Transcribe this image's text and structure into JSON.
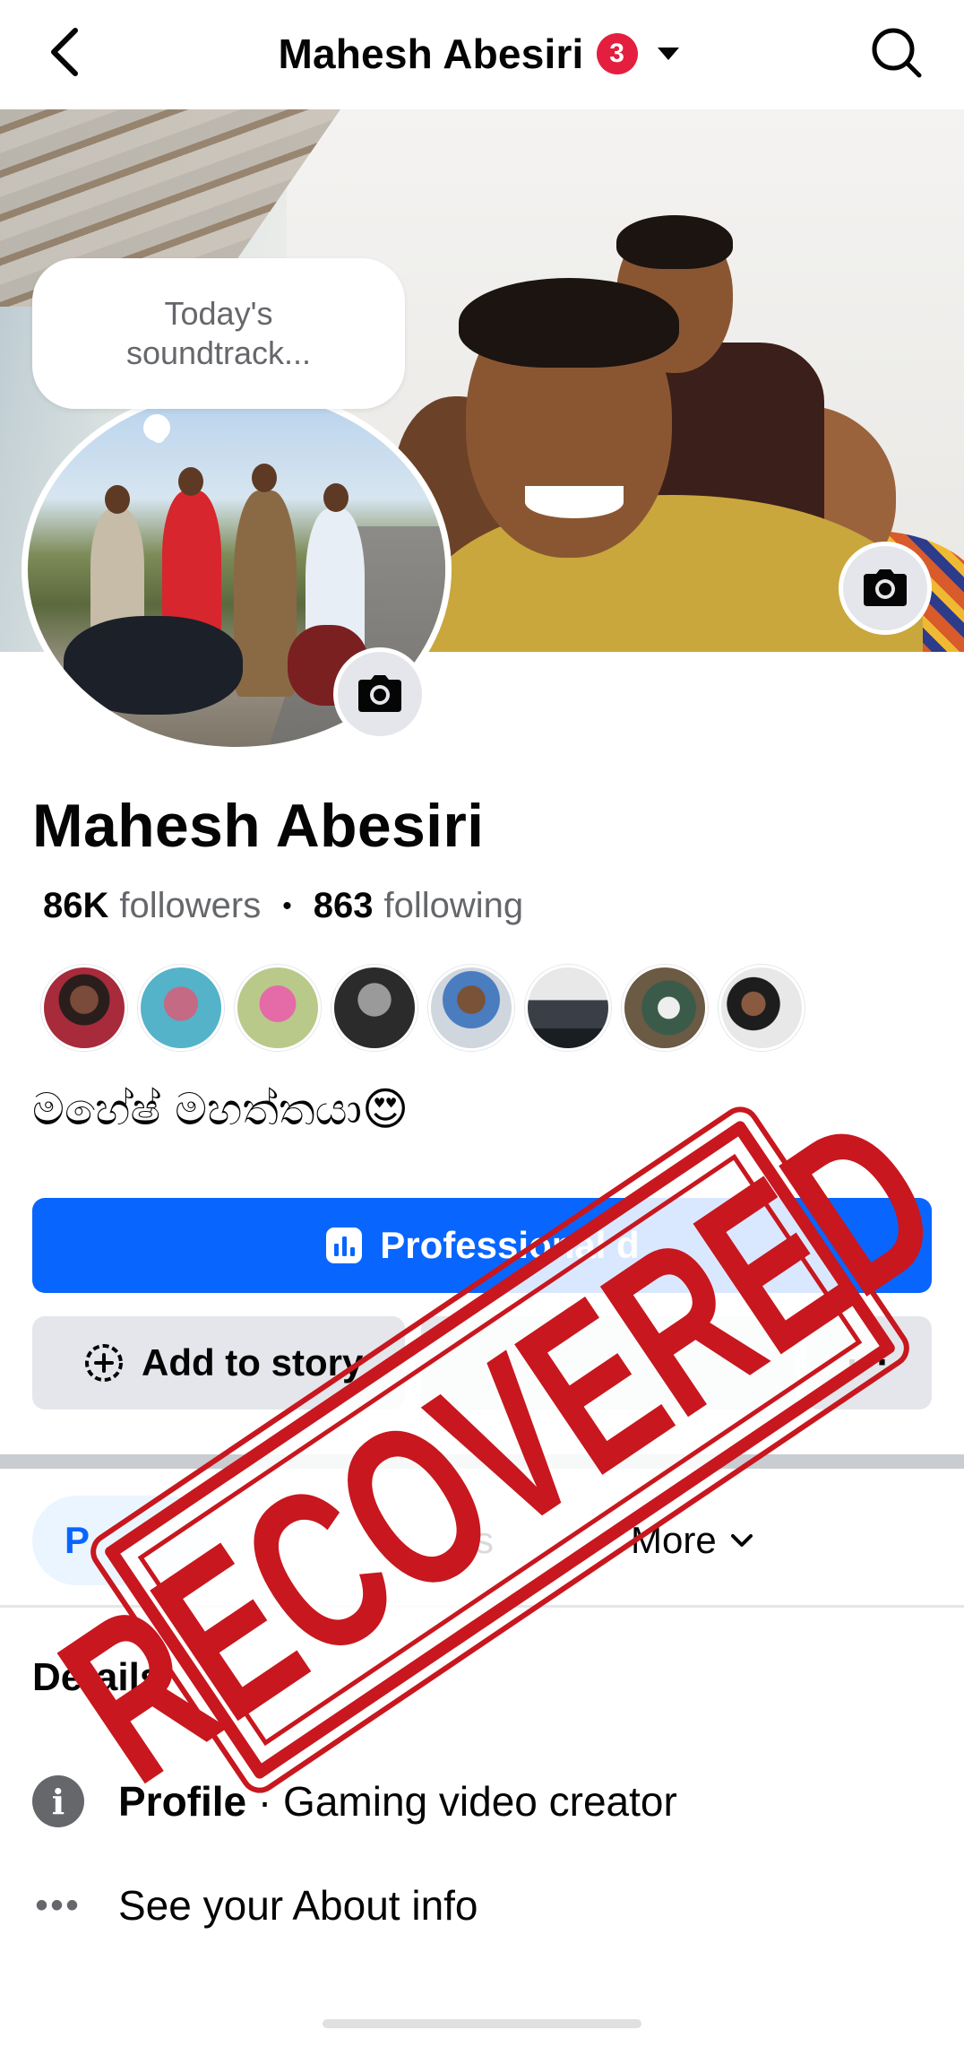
{
  "header": {
    "title": "Mahesh Abesiri",
    "notification_count": "3"
  },
  "bubble": {
    "text": "Today's\nsoundtrack..."
  },
  "profile": {
    "name": "Mahesh Abesiri",
    "followers_count": "86K",
    "followers_label": "followers",
    "following_count": "863",
    "following_label": "following",
    "bio": "මහේෂ් මහත්තයා😍"
  },
  "buttons": {
    "professional": "Professional d",
    "add_to_story": "Add to story",
    "more": "···"
  },
  "tabs": {
    "posts": "P",
    "reels": "s",
    "more": "More"
  },
  "details": {
    "title": "Details",
    "profile_label": "Profile",
    "profile_separator": " · ",
    "profile_value": "Gaming video creator",
    "about": "See your About info"
  },
  "stamp": {
    "text": "RECOVERED"
  },
  "colors": {
    "primary": "#0866ff",
    "badge": "#e41e3f",
    "stamp": "#c8171e"
  }
}
